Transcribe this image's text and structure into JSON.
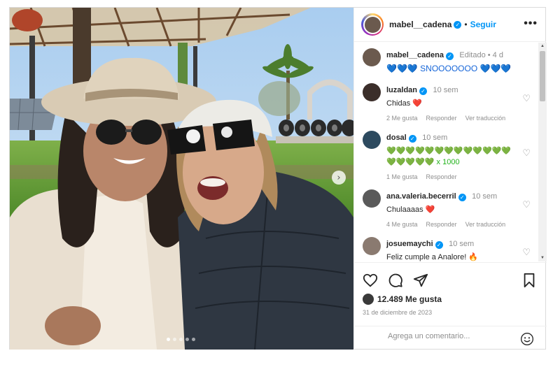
{
  "post": {
    "username": "mabel__cadena",
    "separator": "•",
    "follow_label": "Seguir",
    "more_label": "•••",
    "likes": "12.489 Me gusta",
    "date": "31 de diciembre de 2023",
    "comment_placeholder": "Agrega un comentario...",
    "carousel_next": "›"
  },
  "caption": {
    "username": "mabel__cadena",
    "time": "Editado • 4 d",
    "text": "💙💙💙 SNOOOOOOO 💙💙💙"
  },
  "comments": [
    {
      "username": "luzaldan",
      "time": "10 sem",
      "text": "Chidas ❤️",
      "likes": "2 Me gusta",
      "reply": "Responder",
      "translate": "Ver traducción"
    },
    {
      "username": "dosal",
      "time": "10 sem",
      "text": "💚💚💚💚💚💚💚💚💚💚💚💚💚💚💚💚💚💚 x 1000",
      "likes": "1 Me gusta",
      "reply": "Responder"
    },
    {
      "username": "ana.valeria.becerril",
      "time": "10 sem",
      "text": "Chulaaaas ❤️",
      "likes": "4 Me gusta",
      "reply": "Responder",
      "translate": "Ver traducción"
    },
    {
      "username": "josuemaychi",
      "time": "10 sem",
      "text": "Feliz cumple a Analore! 🔥"
    }
  ],
  "icons": {
    "heart": "heart-icon",
    "comment": "comment-icon",
    "share": "share-icon",
    "bookmark": "bookmark-icon",
    "emoji": "emoji-icon",
    "verified": "verified-badge-icon"
  },
  "colors": {
    "accent": "#0095f6",
    "like_red": "#ed4956",
    "muted": "#8e8e8e",
    "text": "#262626"
  }
}
